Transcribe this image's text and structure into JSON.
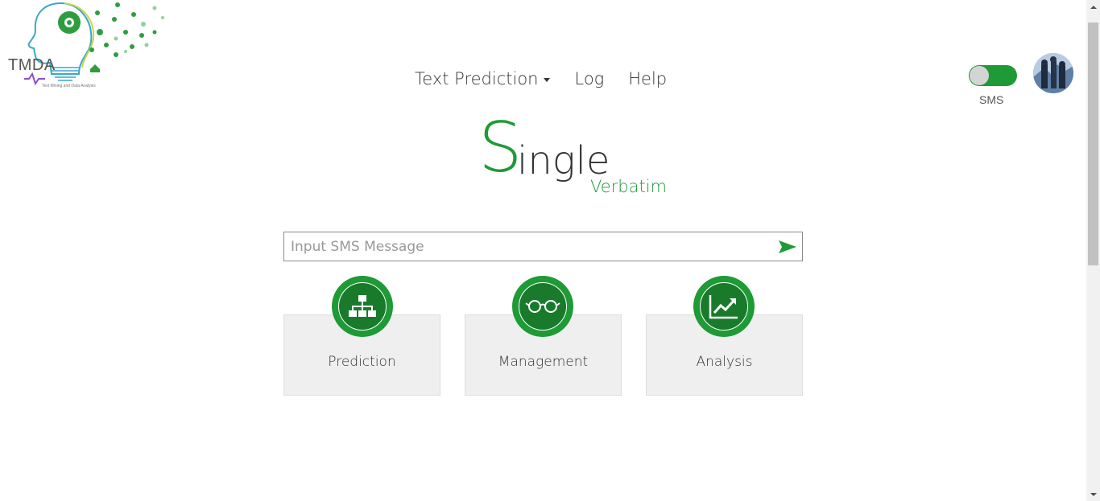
{
  "logo": {
    "text": "TMDA",
    "subtitle": "Text Mining and Data Analysis"
  },
  "nav": {
    "items": [
      {
        "label": "Text Prediction",
        "has_dropdown": true
      },
      {
        "label": "Log"
      },
      {
        "label": "Help"
      }
    ]
  },
  "toggle": {
    "label": "SMS",
    "checked": true
  },
  "title": {
    "first_letter": "S",
    "rest": "ingle",
    "subtitle": "Verbatim"
  },
  "search": {
    "placeholder": "Input SMS Message",
    "value": ""
  },
  "cards": [
    {
      "label": "Prediction",
      "icon": "sitemap-icon"
    },
    {
      "label": "Management",
      "icon": "glasses-icon"
    },
    {
      "label": "Analysis",
      "icon": "line-chart-icon"
    }
  ],
  "colors": {
    "accent": "#1e9a36",
    "accent_dark": "#1a7a2c",
    "card_bg": "#efefef"
  }
}
